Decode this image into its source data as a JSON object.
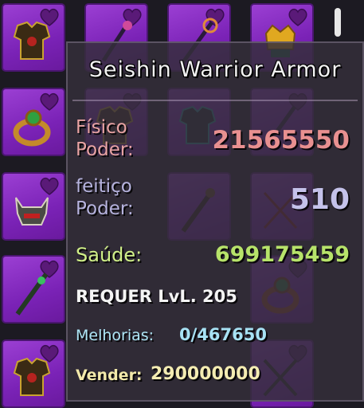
{
  "inventory": {
    "slots": [
      {
        "item_icon": "armor-chest-icon"
      },
      {
        "item_icon": "staff-icon"
      },
      {
        "item_icon": "staff-icon"
      },
      {
        "item_icon": "crown-helmet-icon"
      },
      {
        "item_icon": "ring-icon"
      },
      {
        "item_icon": "armor-chest-icon"
      },
      {
        "item_icon": "armor-dark-icon"
      },
      {
        "item_icon": "staff-icon"
      },
      {
        "item_icon": "horned-helmet-icon"
      },
      {
        "item_icon": "spiked-staff-icon"
      },
      {
        "item_icon": "crossed-spears-icon"
      },
      {
        "item_icon": "green-staff-icon"
      },
      {
        "item_icon": "ring-icon"
      },
      {
        "item_icon": "armor-chest-icon"
      },
      {
        "item_icon": "crossed-spears-icon"
      }
    ],
    "favorite_icon": "heart-icon"
  },
  "tooltip": {
    "title": "Seishin Warrior Armor",
    "physical_power": {
      "label_line1": "Físico",
      "label_line2": "Poder:",
      "value": "21565550"
    },
    "spell_power": {
      "label_line1": "feitiço",
      "label_line2": "Poder:",
      "value": "510"
    },
    "health": {
      "label": "Saúde:",
      "value": "699175459"
    },
    "requirement": "REQUER LvL. 205",
    "upgrades": {
      "label": "Melhorias:",
      "value": "0/467650"
    },
    "sell": {
      "label": "Vender:",
      "value": "290000000"
    }
  },
  "colors": {
    "slot_purple": "#8a2fc6",
    "physical": "#e89090",
    "spell": "#c4c2ea",
    "health": "#b7e36a",
    "upgrades": "#a7e2f4",
    "sell": "#f4ecb2"
  }
}
